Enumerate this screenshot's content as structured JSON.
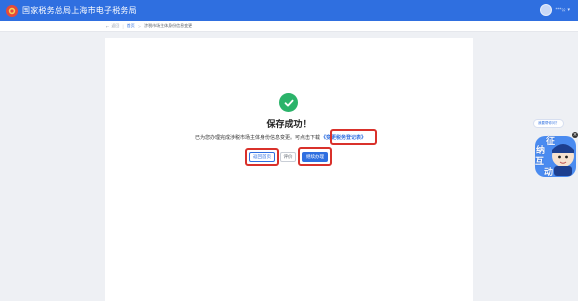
{
  "header": {
    "site_title": "国家税务总局上海市电子税务局",
    "user_name": "***公",
    "emblem_icon": "tax-emblem-icon",
    "avatar_icon": "user-avatar-icon"
  },
  "breadcrumb": {
    "back_label": "返回",
    "home_label": "首页",
    "current_label": "涉税市场主体身份信息变更"
  },
  "result": {
    "title": "保存成功！",
    "message": "已为您办理完成涉税市场主体身份信息变更。可点击下载",
    "record_link": "《变更税务登记表》"
  },
  "actions": {
    "back_home": "返回首页",
    "evaluate": "评价",
    "continue": "继续办理"
  },
  "assistant": {
    "bubble_text": "我要帮你问？",
    "line1": "征",
    "line2": "纳",
    "line3": "互",
    "line4": "动",
    "close_label": "×"
  },
  "colors": {
    "brand_blue": "#2f6fe0",
    "success_green": "#2bb36a",
    "highlight_red": "#d9312b"
  }
}
